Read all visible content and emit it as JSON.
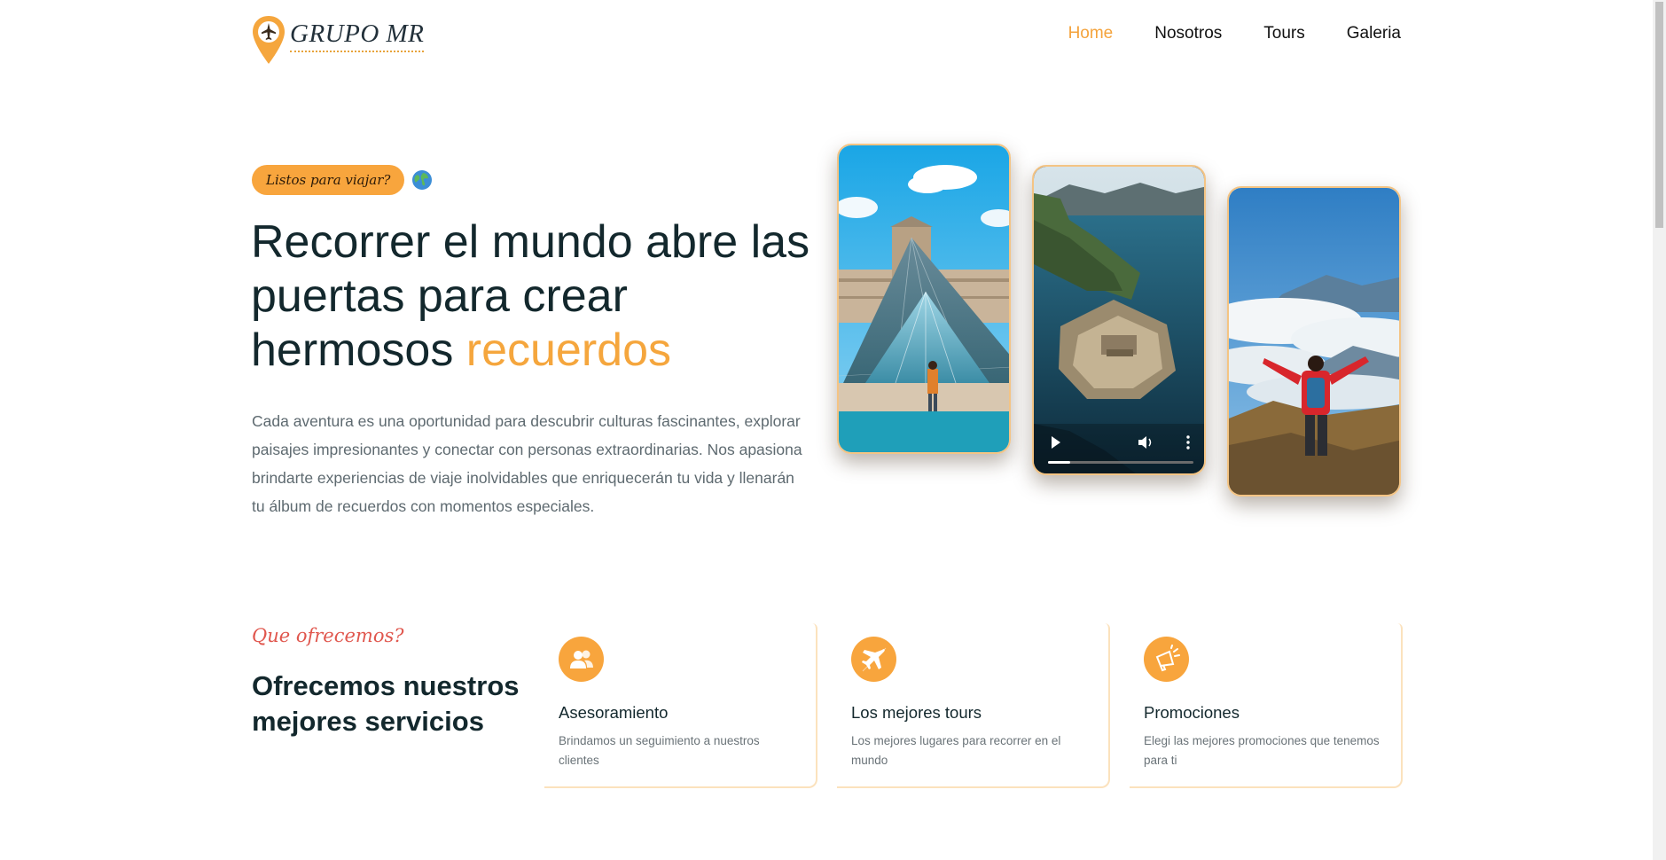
{
  "header": {
    "logo_text": "GRUPO MR",
    "nav": [
      {
        "label": "Home",
        "active": true
      },
      {
        "label": "Nosotros",
        "active": false
      },
      {
        "label": "Tours",
        "active": false
      },
      {
        "label": "Galeria",
        "active": false
      }
    ]
  },
  "hero": {
    "tag": "Listos para viajar?",
    "tag_icon": "globe-icon",
    "title_main": "Recorrer el mundo abre las puertas para crear hermosos ",
    "title_accent": "recuerdos",
    "description": "Cada aventura es una oportunidad para descubrir culturas fascinantes, explorar paisajes impresionantes y conectar con personas extraordinarias. Nos apasiona brindarte experiencias de viaje inolvidables que enriquecerán tu vida y llenarán tu álbum de recuerdos con momentos especiales.",
    "media": [
      {
        "kind": "image",
        "subject": "louvre-pyramid"
      },
      {
        "kind": "video",
        "subject": "coastal-fortress",
        "controls": [
          "play-icon",
          "volume-icon",
          "more-icon"
        ],
        "progress": 0.15
      },
      {
        "kind": "image",
        "subject": "hiker-above-clouds"
      }
    ]
  },
  "services": {
    "kicker": "Que ofrecemos?",
    "title": "Ofrecemos nuestros mejores servicios",
    "cards": [
      {
        "icon": "users-icon",
        "title": "Asesoramiento",
        "text": "Brindamos un seguimiento a nuestros clientes"
      },
      {
        "icon": "airplane-icon",
        "title": "Los mejores tours",
        "text": "Los mejores lugares para recorrer en el mundo"
      },
      {
        "icon": "megaphone-icon",
        "title": "Promociones",
        "text": "Elegi las mejores promociones que tenemos para ti"
      }
    ]
  },
  "colors": {
    "accent": "#f5a63d",
    "heading": "#13282d",
    "kicker": "#e0564d"
  }
}
